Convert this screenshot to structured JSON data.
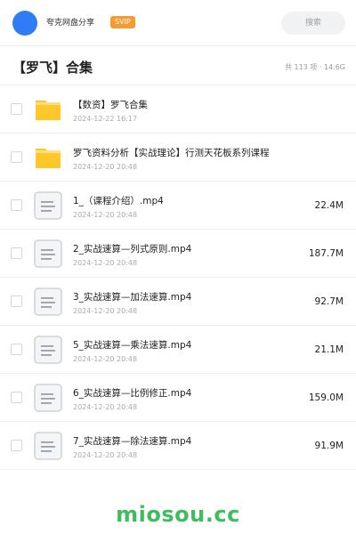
{
  "header": {
    "app_name": "夸克网盘分享",
    "badge": "SVIP",
    "search_placeholder": "搜索"
  },
  "folder": {
    "title": "【罗飞】合集",
    "meta": "共 113 项 · 14.6G"
  },
  "items": [
    {
      "name": "【数资】罗飞合集",
      "date": "2024-12-22 16:17",
      "size": "",
      "type": "folder"
    },
    {
      "name": "罗飞资料分析【实战理论】行测天花板系列课程",
      "date": "2024-12-20 20:48",
      "size": "",
      "type": "folder"
    },
    {
      "name": "1_（课程介绍）.mp4",
      "date": "2024-12-20 20:48",
      "size": "22.4M",
      "type": "file"
    },
    {
      "name": "2_实战速算—列式原则.mp4",
      "date": "2024-12-20 20:48",
      "size": "187.7M",
      "type": "file"
    },
    {
      "name": "3_实战速算—加法速算.mp4",
      "date": "2024-12-20 20:48",
      "size": "92.7M",
      "type": "file"
    },
    {
      "name": "5_实战速算—乘法速算.mp4",
      "date": "2024-12-20 20:48",
      "size": "21.1M",
      "type": "file"
    },
    {
      "name": "6_实战速算—比例修正.mp4",
      "date": "2024-12-20 20:48",
      "size": "159.0M",
      "type": "file"
    },
    {
      "name": "7_实战速算—除法速算.mp4",
      "date": "2024-12-20 20:48",
      "size": "91.9M",
      "type": "file"
    }
  ],
  "watermark": "miosou.cc",
  "colors": {
    "avatar": "#2f7df6",
    "svip_badge": "#f39c33",
    "folder_icon": "#ffc629",
    "watermark": "#3dbd5d"
  }
}
